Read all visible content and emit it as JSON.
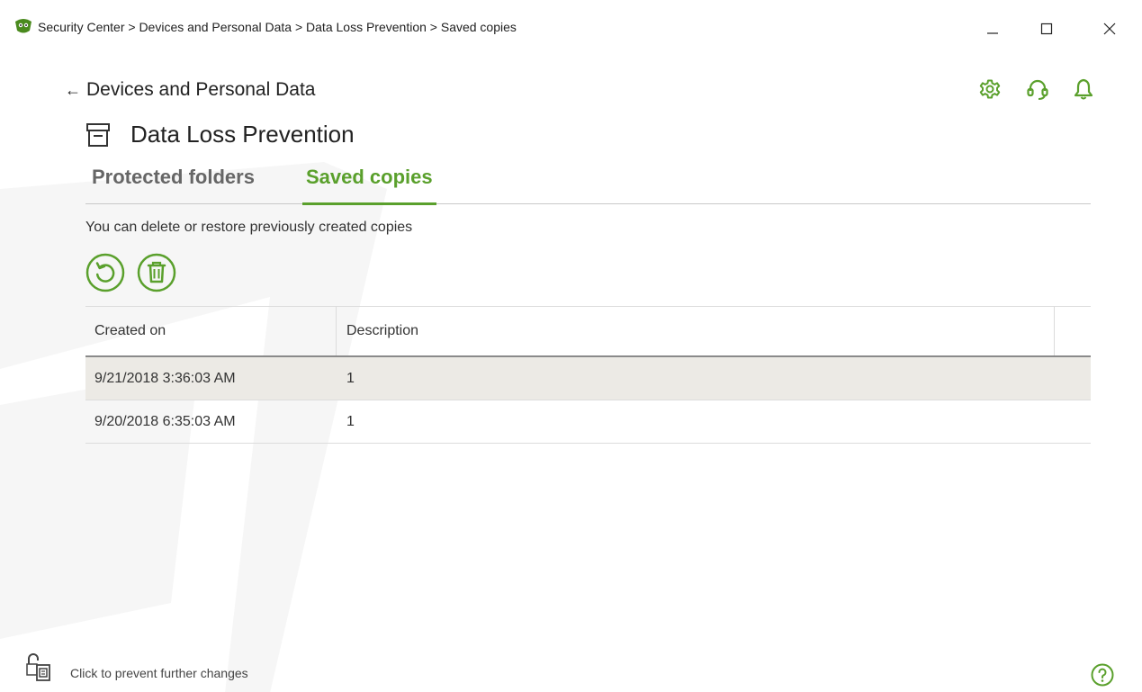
{
  "window": {
    "title": "Security Center > Devices and Personal Data > Data Loss Prevention > Saved copies"
  },
  "nav": {
    "back_label": "Devices and Personal Data",
    "back_arrow": "←"
  },
  "page": {
    "title": "Data Loss Prevention",
    "description": "You can delete or restore previously created copies"
  },
  "tabs": [
    {
      "label": "Protected folders",
      "active": false
    },
    {
      "label": "Saved copies",
      "active": true
    }
  ],
  "toolbar": {
    "restore_icon": "restore-icon",
    "delete_icon": "trash-icon"
  },
  "table": {
    "columns": [
      "Created on",
      "Description"
    ],
    "rows": [
      {
        "created": "9/21/2018 3:36:03 AM",
        "description": "1",
        "selected": true
      },
      {
        "created": "9/20/2018 6:35:03 AM",
        "description": "1",
        "selected": false
      }
    ]
  },
  "footer": {
    "lock_text": "Click to prevent further changes",
    "help_icon": "help-icon"
  },
  "colors": {
    "accent": "#5aa02c",
    "selected_row": "#eceae5",
    "watermark": "#f6f6f6"
  }
}
